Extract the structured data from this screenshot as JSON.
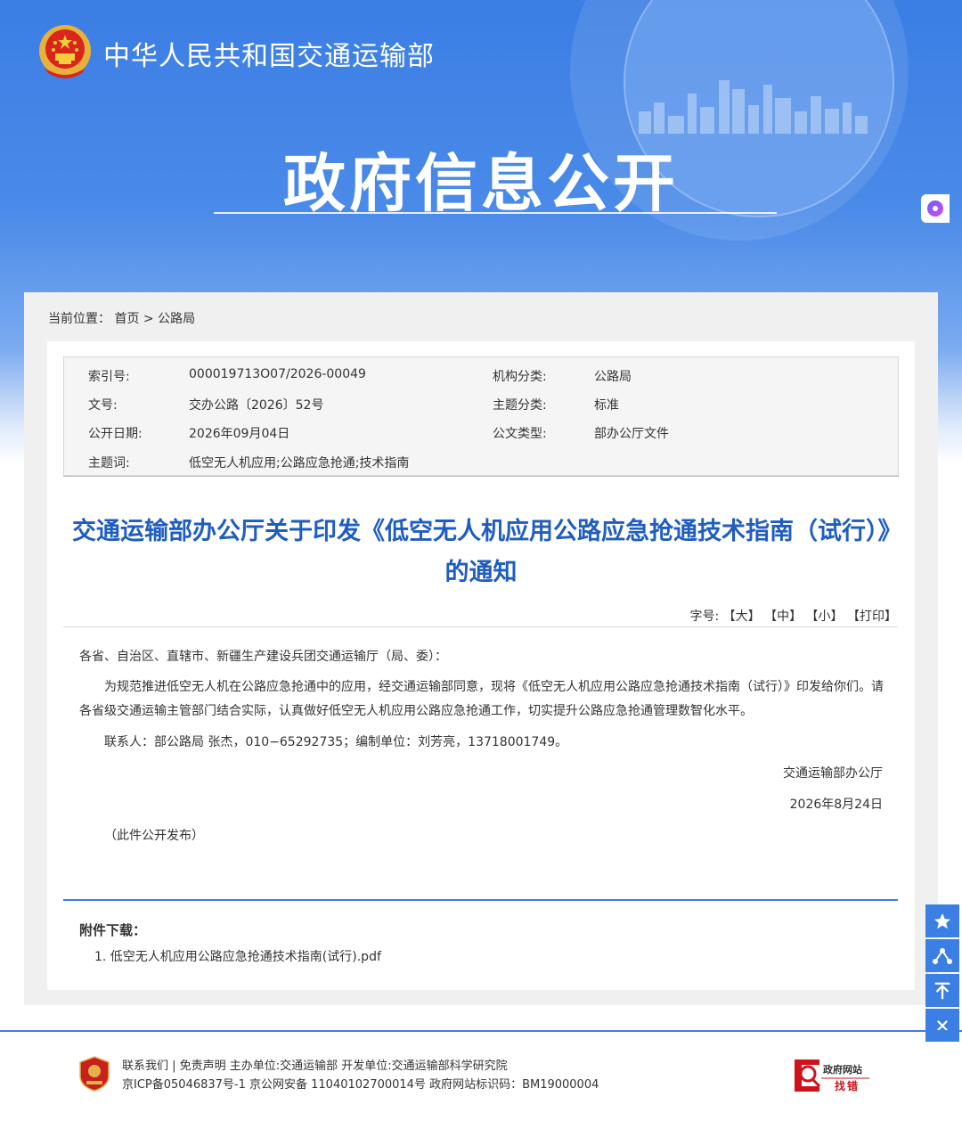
{
  "header": {
    "ministry_name": "中华人民共和国交通运输部",
    "banner_title": "政府信息公开"
  },
  "breadcrumb": {
    "prefix": "当前位置：",
    "home": "首页",
    "separator": ">",
    "current": "公路局"
  },
  "meta": {
    "index_label": "索引号:",
    "index_value": "000019713O07/2026-00049",
    "org_label": "机构分类:",
    "org_value": "公路局",
    "docno_label": "文号:",
    "docno_value": "交办公路〔2026〕52号",
    "topic_label": "主题分类:",
    "topic_value": "标准",
    "date_label": "公开日期:",
    "date_value": "2026年09月04日",
    "type_label": "公文类型:",
    "type_value": "部办公厅文件",
    "keywords_label": "主题词:",
    "keywords_value": "低空无人机应用;公路应急抢通;技术指南"
  },
  "article": {
    "title": "交通运输部办公厅关于印发《低空无人机应用公路应急抢通技术指南（试行）》的通知",
    "font_size_label": "字号:",
    "font_large": "【大】",
    "font_medium": "【中】",
    "font_small": "【小】",
    "print": "【打印】",
    "salutation": "各省、自治区、直辖市、新疆生产建设兵团交通运输厅（局、委）：",
    "paragraph": "为规范推进低空无人机在公路应急抢通中的应用，经交通运输部同意，现将《低空无人机应用公路应急抢通技术指南（试行）》印发给你们。请各省级交通运输主管部门结合实际，认真做好低空无人机应用公路应急抢通工作，切实提升公路应急抢通管理数智化水平。",
    "contact": "联系人：部公路局 张杰，010−65292735；编制单位：刘芳亮，13718001749。",
    "issuer": "交通运输部办公厅",
    "issue_date": "2026年8月24日",
    "note": "（此件公开发布）"
  },
  "attachments": {
    "title": "附件下载：",
    "items": [
      {
        "label": "1. 低空无人机应用公路应急抢通技术指南(试行).pdf"
      }
    ]
  },
  "side_toolbar": [
    "star-icon",
    "share-icon",
    "back-to-top-icon",
    "close-icon"
  ],
  "footer": {
    "line1": "联系我们 | 免责声明 主办单位:交通运输部 开发单位:交通运输部科学研究院",
    "line2": "京ICP备05046837号-1  京公网安备 11040102700014号  政府网站标识码：BM19000004",
    "report_title": "政府网站",
    "report_action": "找错"
  },
  "colors": {
    "brand_blue": "#3b7ee4",
    "title_blue": "#1f5dbf",
    "report_red": "#d0121b"
  }
}
